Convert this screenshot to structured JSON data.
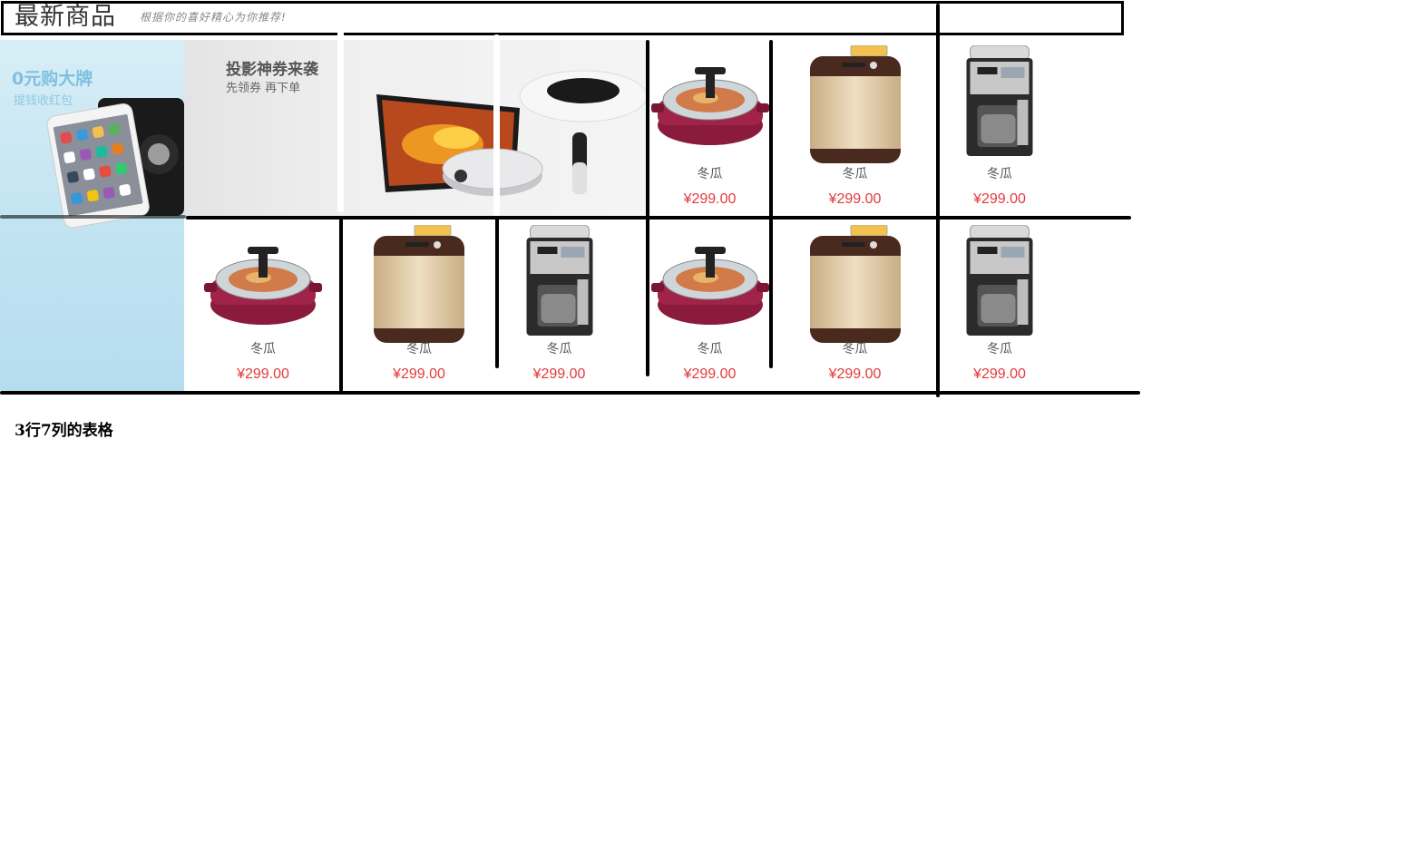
{
  "header": {
    "title": "最新商品",
    "subtitle": "根据你的喜好精心为你推荐!"
  },
  "banners": {
    "left": {
      "title": "0元购大牌",
      "subtitle": "提钱收红包"
    },
    "center": {
      "title": "投影神券来袭",
      "subtitle": "先领券 再下单"
    }
  },
  "products": [
    {
      "icon": "electric-skillet-icon",
      "name": "冬瓜",
      "price": "¥299.00"
    },
    {
      "icon": "bread-maker-icon",
      "name": "冬瓜",
      "price": "¥299.00"
    },
    {
      "icon": "coffee-maker-icon",
      "name": "冬瓜",
      "price": "¥299.00"
    },
    {
      "icon": "electric-skillet-icon",
      "name": "冬瓜",
      "price": "¥299.00"
    },
    {
      "icon": "bread-maker-icon",
      "name": "冬瓜",
      "price": "¥299.00"
    },
    {
      "icon": "coffee-maker-icon",
      "name": "冬瓜",
      "price": "¥299.00"
    },
    {
      "icon": "electric-skillet-icon",
      "name": "冬瓜",
      "price": "¥299.00"
    },
    {
      "icon": "bread-maker-icon",
      "name": "冬瓜",
      "price": "¥299.00"
    },
    {
      "icon": "coffee-maker-icon",
      "name": "冬瓜",
      "price": "¥299.00"
    }
  ],
  "caption": "3行7列的表格",
  "colors": {
    "price": "#e4393c",
    "border": "#000000",
    "banner_blue": "#c4e5f2"
  }
}
